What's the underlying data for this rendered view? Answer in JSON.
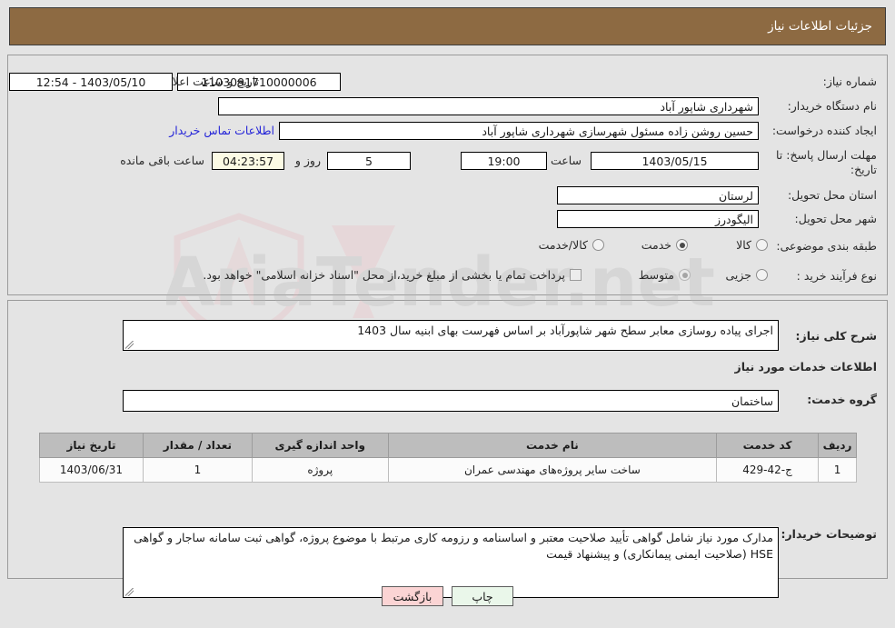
{
  "header": {
    "title": "جزئیات اطلاعات نیاز"
  },
  "form": {
    "need_number_label": "شماره نیاز:",
    "need_number_value": "1103091710000006",
    "announce_datetime_label": "تاریخ و ساعت اعلان عمومی:",
    "announce_datetime_value": "1403/05/10 - 12:54",
    "buyer_org_label": "نام دستگاه خریدار:",
    "buyer_org_value": "شهرداری شاپور آباد",
    "requester_label": "ایجاد کننده درخواست:",
    "requester_value": "حسین روشن زاده مسئول شهرسازی شهرداری شاپور آباد",
    "contact_link": "اطلاعات تماس خریدار",
    "deadline_label": "مهلت ارسال پاسخ: تا تاریخ:",
    "deadline_date": "1403/05/15",
    "hour_label": "ساعت",
    "deadline_time": "19:00",
    "days_value": "5",
    "days_label": "روز و",
    "countdown_value": "04:23:57",
    "remaining_label": "ساعت باقی مانده",
    "province_label": "استان محل تحویل:",
    "province_value": "لرستان",
    "city_label": "شهر محل تحویل:",
    "city_value": "الیگودرز",
    "category_label": "طبقه بندی موضوعی:",
    "category_options": [
      {
        "label": "کالا",
        "selected": false
      },
      {
        "label": "خدمت",
        "selected": true
      },
      {
        "label": "کالا/خدمت",
        "selected": false
      }
    ],
    "process_label": "نوع فرآیند خرید :",
    "process_options": [
      {
        "label": "جزیی",
        "selected": false
      },
      {
        "label": "متوسط",
        "selected": true
      }
    ],
    "treasury_checkbox_label": "پرداخت تمام یا بخشی از مبلغ خرید،از محل \"اسناد خزانه اسلامی\" خواهد بود.",
    "treasury_checked": false
  },
  "details": {
    "general_desc_label": "شرح کلی نیاز:",
    "general_desc_value": "اجرای پیاده روسازی معابر سطح شهر شاپورآباد بر اساس فهرست بهای ابنیه سال 1403",
    "services_section_title": "اطلاعات خدمات مورد نیاز",
    "service_group_label": "گروه خدمت:",
    "service_group_value": "ساختمان",
    "buyer_notes_label": "توضیحات خریدار:",
    "buyer_notes_value": "مدارک مورد نیاز شامل گواهی تأیید صلاحیت معتبر و اساسنامه و رزومه کاری مرتبط با موضوع پروژه، گواهی ثبت سامانه ساجار و گواهی HSE (صلاحیت ایمنی پیمانکاری) و پیشنهاد قیمت"
  },
  "table": {
    "columns": [
      "ردیف",
      "کد خدمت",
      "نام خدمت",
      "واحد اندازه گیری",
      "تعداد / مقدار",
      "تاریخ نیاز"
    ],
    "rows": [
      [
        "1",
        "ج-42-429",
        "ساخت سایر پروژه‌های مهندسی عمران",
        "پروژه",
        "1",
        "1403/06/31"
      ]
    ]
  },
  "buttons": {
    "print": "چاپ",
    "back": "بازگشت"
  },
  "watermark": {
    "text": "AriaTender.net"
  },
  "colors": {
    "header_bg": "#8d6a42",
    "page_bg": "#e4e4e4",
    "link": "#2424d8",
    "countdown_bg": "#fbfae4",
    "print_btn_bg": "#eaf7ea",
    "back_btn_bg": "#fbd4d4",
    "table_header_bg": "#bdbdbd"
  }
}
